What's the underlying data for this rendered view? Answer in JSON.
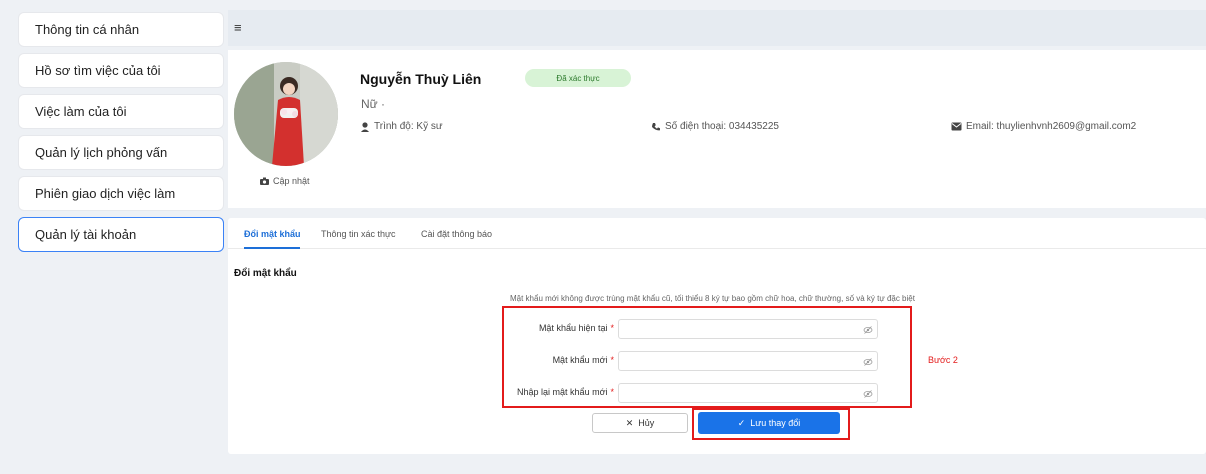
{
  "sidebar": {
    "items": [
      {
        "label": "Thông tin cá nhân"
      },
      {
        "label": "Hồ sơ tìm việc của tôi"
      },
      {
        "label": "Việc làm của tôi"
      },
      {
        "label": "Quản lý lịch phỏng vấn"
      },
      {
        "label": "Phiên giao dịch việc làm"
      },
      {
        "label": "Quản lý tài khoản",
        "active": true
      }
    ]
  },
  "topbar": {
    "menu_icon": "≡"
  },
  "profile": {
    "name": "Nguyễn Thuỳ Liên",
    "verified_badge": "Đã xác thực",
    "gender": "Nữ ·",
    "update_label": "Cập nhật",
    "level": "Trình độ: Kỹ sư",
    "phone": "Số điện thoại: 034435225",
    "email": "Email: thuylienhvnh2609@gmail.com2",
    "icons": [
      "camera-icon",
      "graduation-icon",
      "phone-icon",
      "mail-icon"
    ]
  },
  "tabs": [
    {
      "label": "Đổi mật khẩu",
      "active": true
    },
    {
      "label": "Thông tin xác thực"
    },
    {
      "label": "Cài đặt thông báo"
    }
  ],
  "form": {
    "title": "Đổi mật khẩu",
    "hint": "Mật khẩu mới không được trùng mật khẩu cũ, tối thiểu 8 ký tự bao gồm chữ hoa, chữ thường, số và ký tự đặc biệt",
    "fields": [
      {
        "label": "Mật khẩu hiện tại",
        "value": ""
      },
      {
        "label": "Mật khẩu mới",
        "value": ""
      },
      {
        "label": "Nhập lại mật khẩu mới",
        "value": ""
      }
    ],
    "required_mark": "*",
    "step_label": "Bước 2",
    "cancel_label": "Hủy",
    "save_label": "Lưu thay đổi"
  },
  "colors": {
    "accent": "#1a73e8",
    "highlight": "#e31b1b",
    "verified_bg": "#d8f3d6"
  }
}
